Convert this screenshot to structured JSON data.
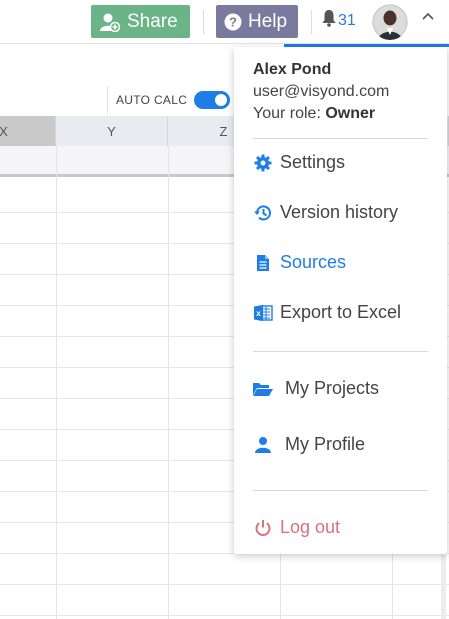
{
  "topbar": {
    "share_label": "Share",
    "help_label": "Help",
    "notification_count": "31"
  },
  "sheet": {
    "auto_calc_label": "AUTO CALC",
    "auto_calc_on": true,
    "columns": [
      "X",
      "Y",
      "Z"
    ]
  },
  "user_menu": {
    "name": "Alex Pond",
    "email": "user@visyond.com",
    "role_prefix": "Your role: ",
    "role": "Owner",
    "items": [
      {
        "label": "Settings",
        "icon": "gear-icon"
      },
      {
        "label": "Version history",
        "icon": "history-icon"
      },
      {
        "label": "Sources",
        "icon": "document-icon"
      },
      {
        "label": "Export to Excel",
        "icon": "excel-icon"
      },
      {
        "label": "My Projects",
        "icon": "folder-open-icon"
      },
      {
        "label": "My Profile",
        "icon": "user-icon"
      },
      {
        "label": "Log out",
        "icon": "power-icon"
      }
    ]
  },
  "colors": {
    "share": "#6ab487",
    "help": "#7a7a9e",
    "accent": "#1f7ee5",
    "logout": "#d9727e"
  }
}
